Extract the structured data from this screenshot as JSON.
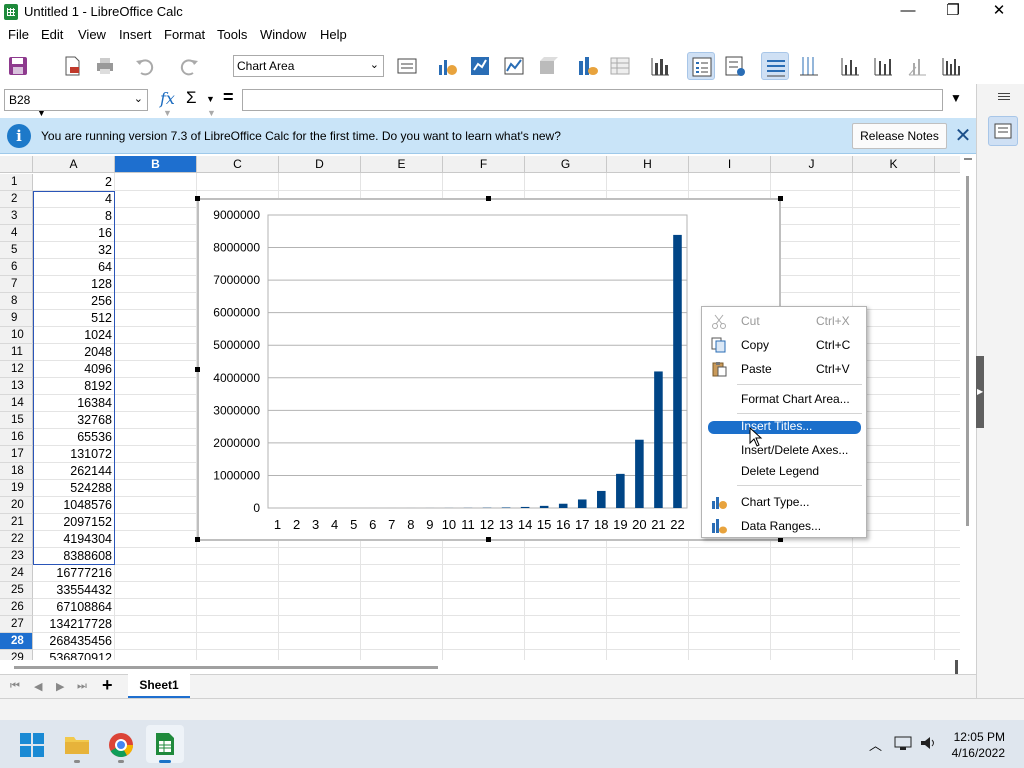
{
  "window": {
    "title": "Untitled 1 - LibreOffice Calc",
    "minimize_glyph": "—",
    "maximize_glyph": "❐",
    "close_glyph": "✕"
  },
  "menu": [
    "File",
    "Edit",
    "View",
    "Insert",
    "Format",
    "Tools",
    "Window",
    "Help"
  ],
  "toolbar": {
    "chart_element_select": "Chart Area"
  },
  "formula_bar": {
    "name_box": "B28",
    "function_glyph": "fx",
    "sum_glyph": "Σ",
    "equals_glyph": "=",
    "formula_value": ""
  },
  "infobar": {
    "message": "You are running version 7.3 of LibreOffice Calc for the first time. Do you want to learn what's new?",
    "button": "Release Notes",
    "close_glyph": "✕"
  },
  "grid": {
    "columns": [
      "A",
      "B",
      "C",
      "D",
      "E",
      "F",
      "G",
      "H",
      "I",
      "J",
      "K"
    ],
    "selected_column": "B",
    "rows": [
      "1",
      "2",
      "3",
      "4",
      "5",
      "6",
      "7",
      "8",
      "9",
      "10",
      "11",
      "12",
      "13",
      "14",
      "15",
      "16",
      "17",
      "18",
      "19",
      "20",
      "21",
      "22",
      "23",
      "24",
      "25",
      "26",
      "27",
      "28",
      "29"
    ],
    "selected_row": "28",
    "column_a": [
      "2",
      "4",
      "8",
      "16",
      "32",
      "64",
      "128",
      "256",
      "512",
      "1024",
      "2048",
      "4096",
      "8192",
      "16384",
      "32768",
      "65536",
      "131072",
      "262144",
      "524288",
      "1048576",
      "2097152",
      "4194304",
      "8388608",
      "16777216",
      "33554432",
      "67108864",
      "134217728",
      "268435456",
      "536870912"
    ]
  },
  "chart_data": {
    "type": "bar",
    "categories": [
      "1",
      "2",
      "3",
      "4",
      "5",
      "6",
      "7",
      "8",
      "9",
      "10",
      "11",
      "12",
      "13",
      "14",
      "15",
      "16",
      "17",
      "18",
      "19",
      "20",
      "21",
      "22"
    ],
    "values": [
      4,
      8,
      16,
      32,
      64,
      128,
      256,
      512,
      1024,
      2048,
      4096,
      8192,
      16384,
      32768,
      65536,
      131072,
      262144,
      524288,
      1048576,
      2097152,
      4194304,
      8388608
    ],
    "y_ticks": [
      "0",
      "1000000",
      "2000000",
      "3000000",
      "4000000",
      "5000000",
      "6000000",
      "7000000",
      "8000000",
      "9000000"
    ],
    "ylim": [
      0,
      9000000
    ],
    "grid": true,
    "legend": "none",
    "bar_color": "#004586",
    "title": "",
    "xlabel": "",
    "ylabel": ""
  },
  "context_menu": {
    "items": [
      {
        "label": "Cut",
        "shortcut": "Ctrl+X",
        "icon": "scissors-icon",
        "disabled": true
      },
      {
        "label": "Copy",
        "shortcut": "Ctrl+C",
        "icon": "copy-icon",
        "disabled": false
      },
      {
        "label": "Paste",
        "shortcut": "Ctrl+V",
        "icon": "paste-icon",
        "disabled": false
      },
      {
        "label": "Format Chart Area...",
        "shortcut": "",
        "icon": "",
        "disabled": false
      },
      {
        "label": "Insert Titles...",
        "shortcut": "",
        "icon": "",
        "disabled": false,
        "highlighted": true
      },
      {
        "label": "Insert/Delete Axes...",
        "shortcut": "",
        "icon": "",
        "disabled": false
      },
      {
        "label": "Delete Legend",
        "shortcut": "",
        "icon": "",
        "disabled": false
      },
      {
        "label": "Chart Type...",
        "shortcut": "",
        "icon": "chart-type-icon",
        "disabled": false
      },
      {
        "label": "Data Ranges...",
        "shortcut": "",
        "icon": "data-ranges-icon",
        "disabled": false
      }
    ]
  },
  "sheet_tabs": {
    "add_glyph": "+",
    "active": "Sheet1"
  },
  "taskbar": {
    "time": "12:05 PM",
    "date": "4/16/2022"
  },
  "colors": {
    "accent": "#1e6fcf",
    "infobar_bg": "#c9e4f8",
    "bar": "#004586"
  }
}
